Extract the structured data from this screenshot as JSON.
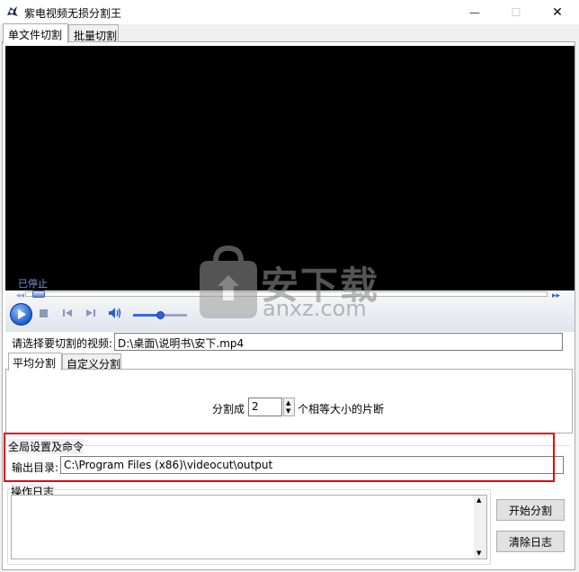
{
  "window": {
    "title": "紫电视频无损分割王",
    "minimize_glyph": "—",
    "maximize_glyph": "☐",
    "close_glyph": "✕"
  },
  "tabs": [
    {
      "label": "单文件切割",
      "active": true
    },
    {
      "label": "批量切割",
      "active": false
    }
  ],
  "player": {
    "status": "已停止"
  },
  "video_select": {
    "label": "请选择要切割的视频:",
    "value": "D:\\桌面\\说明书\\安下.mp4"
  },
  "split_tabs": [
    {
      "label": "平均分割",
      "active": true
    },
    {
      "label": "自定义分割",
      "active": false
    }
  ],
  "split": {
    "prefix": "分割成",
    "count": "2",
    "suffix": "个相等大小的片断"
  },
  "global": {
    "group_label": "全局设置及命令",
    "output_label": "输出目录:",
    "output_value": "C:\\Program Files (x86)\\videocut\\output"
  },
  "log": {
    "group_label": "操作日志",
    "value": ""
  },
  "buttons": {
    "start": "开始分割",
    "clear_log": "清除日志"
  },
  "watermark": {
    "brand": "安下载",
    "domain": "anxz.com"
  },
  "colors": {
    "highlight": "#e8000b",
    "status_text": "#7b8dd8"
  }
}
